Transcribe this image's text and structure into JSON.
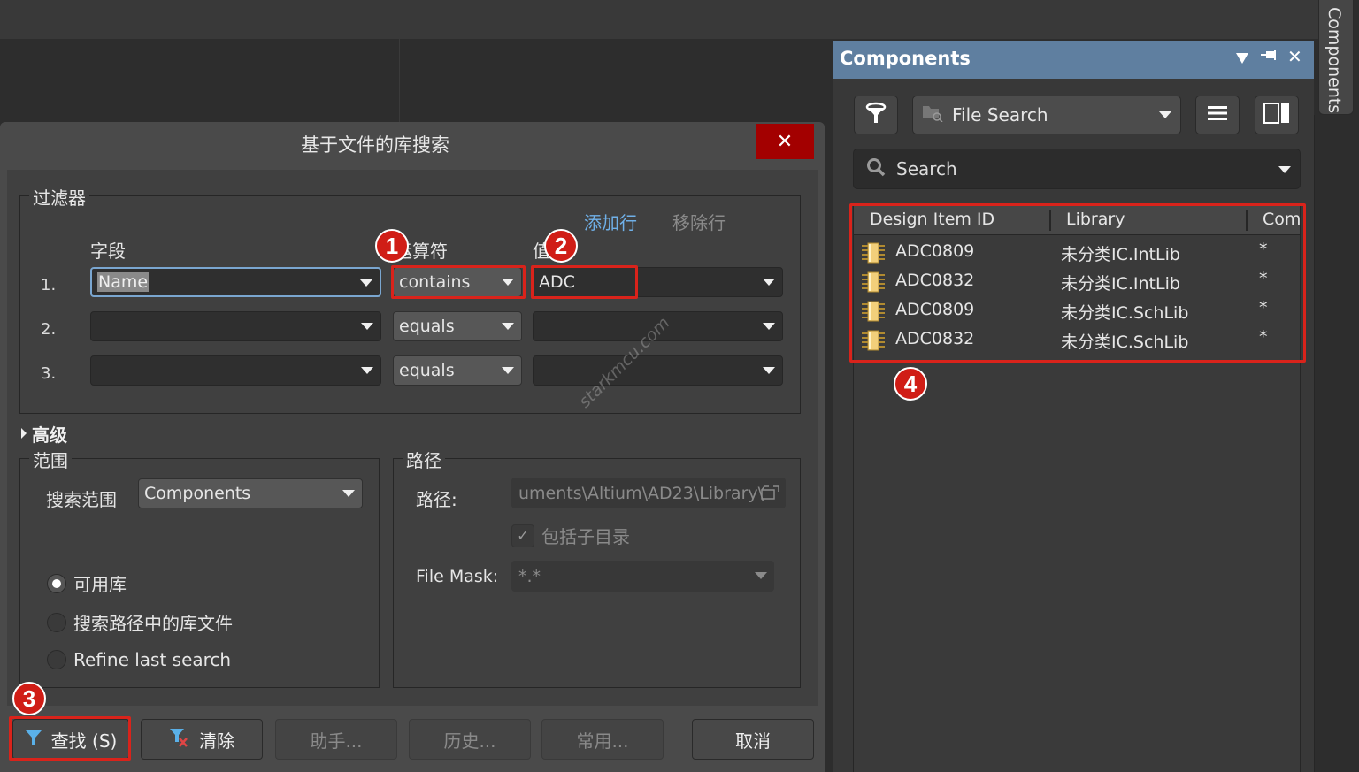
{
  "dialog": {
    "title": "基于文件的库搜索",
    "close_label": "✕",
    "filters": {
      "group_title": "过滤器",
      "add_row": "添加行",
      "remove_row": "移除行",
      "col_field": "字段",
      "col_operator": "运算符",
      "col_value": "值",
      "rows": [
        {
          "num": "1.",
          "field": "Name",
          "operator": "contains",
          "value": "ADC"
        },
        {
          "num": "2.",
          "field": "",
          "operator": "equals",
          "value": ""
        },
        {
          "num": "3.",
          "field": "",
          "operator": "equals",
          "value": ""
        }
      ]
    },
    "advanced_label": "高级",
    "scope": {
      "group_title": "范围",
      "search_scope_label": "搜索范围",
      "search_scope_value": "Components",
      "radios": [
        {
          "label": "可用库",
          "selected": true
        },
        {
          "label": "搜索路径中的库文件",
          "selected": false
        },
        {
          "label": "Refine last search",
          "selected": false
        }
      ]
    },
    "path": {
      "group_title": "路径",
      "path_label": "路径:",
      "path_value": "uments\\Altium\\AD23\\Library\\",
      "include_subdirs_label": "包括子目录",
      "include_subdirs_checked": true,
      "file_mask_label": "File Mask:",
      "file_mask_value": "*.*"
    },
    "buttons": {
      "search": "查找 (S)",
      "clear": "清除",
      "helper": "助手...",
      "history": "历史...",
      "favorites": "常用...",
      "cancel": "取消"
    },
    "watermark": "starkmcu.com"
  },
  "annotations": {
    "badge1": "1",
    "badge2": "2",
    "badge3": "3",
    "badge4": "4",
    "highlight_color": "#d9231b"
  },
  "components_panel": {
    "title": "Components",
    "source_value": "File Search",
    "search_placeholder": "Search",
    "columns": [
      "Design Item ID",
      "Library",
      "Com"
    ],
    "rows": [
      {
        "id": "ADC0809",
        "library": "未分类IC.IntLib",
        "comment": "*"
      },
      {
        "id": "ADC0832",
        "library": "未分类IC.IntLib",
        "comment": "*"
      },
      {
        "id": "ADC0809",
        "library": "未分类IC.SchLib",
        "comment": "*"
      },
      {
        "id": "ADC0832",
        "library": "未分类IC.SchLib",
        "comment": "*"
      }
    ],
    "side_tab_label": "Components",
    "header_color": "#5f7fa0"
  }
}
